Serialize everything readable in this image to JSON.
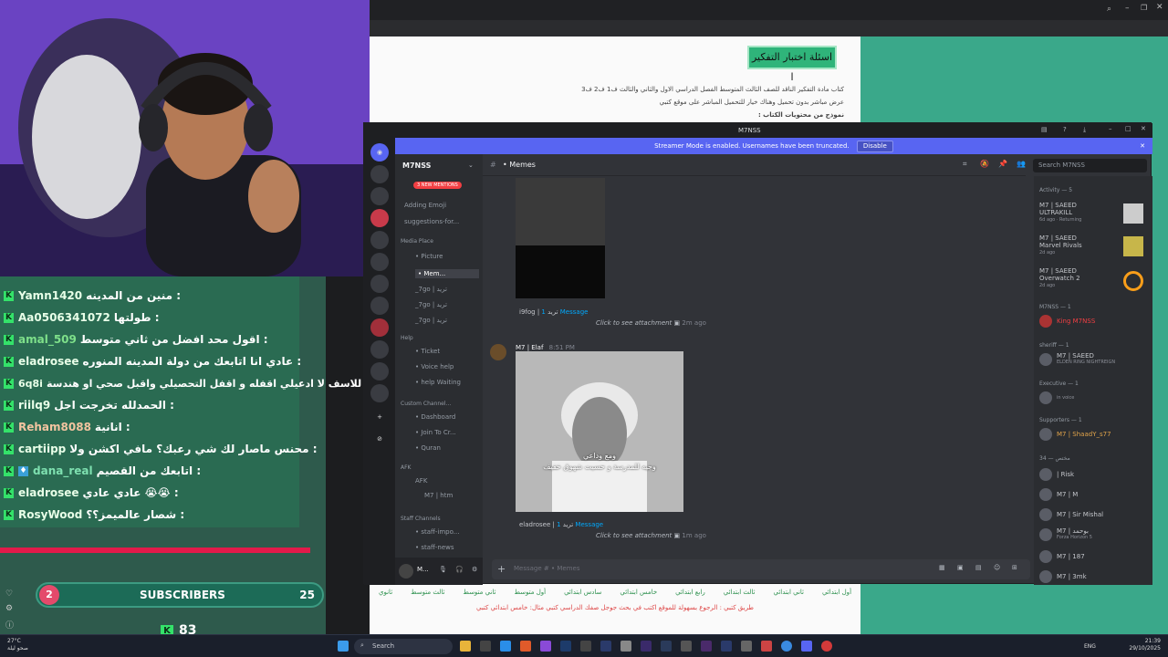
{
  "chat": {
    "messages": [
      {
        "user": "Yamn1420",
        "color": "#e8ffe8",
        "text": "منين من المدينه :"
      },
      {
        "user": "Aa0506341072",
        "color": "#e8ffe8",
        "text": "طولتها :"
      },
      {
        "user": "amal_509",
        "color": "#7ee08a",
        "text": "اقول محد افضل من ثاني متوسط :"
      },
      {
        "user": "eladrosee",
        "color": "#e8ffe8",
        "text": "عادي انا اتابعك من دولة المدينه المنوره :"
      },
      {
        "user": "6q8i",
        "color": "#e8ffe8",
        "text": "للاسف لا ادعيلي اقفله و اقفل التحصيلي واقبل صحي او هندسة :"
      },
      {
        "user": "riilq9",
        "color": "#e8ffe8",
        "text": "الحمدلله تخرجت اجل :"
      },
      {
        "user": "Reham8088",
        "color": "#f2c4a0",
        "text": "انانية :"
      },
      {
        "user": "cartiipp",
        "color": "#e8ffe8",
        "text": "محنس ماصار لك شي رعبك؟ مافي اكشن ولا :"
      },
      {
        "user": "dana_real",
        "color": "#7ee0b0",
        "text": "اتابعك من القصيم :"
      },
      {
        "user": "eladrosee",
        "color": "#e8ffe8",
        "text": "عادي عادي 😭😭 :"
      },
      {
        "user": "RosyWood",
        "color": "#e8ffe8",
        "text": "شصار عالميمز؟؟ :"
      }
    ]
  },
  "subs": {
    "current": "2",
    "label": "SUBSCRIBERS",
    "goal": "25"
  },
  "kick_followers": "83",
  "article": {
    "highlight": "اسئلة اختبار التفكير ا",
    "line1": "كتاب مادة التفكير الناقد للصف الثالث المتوسط الفصل الدراسي الاول والثاني والثالث ف1 ف2 ف3",
    "line2": "عرض مباشر بدون تحميل وهناك خيار للتحميل المباشر على موقع كتبي",
    "line3": "نموذج من محتويات الكتاب :",
    "bottom_tabs": [
      "ثانوي",
      "ثالث متوسط",
      "ثاني متوسط",
      "أول متوسط",
      "سادس ابتدائي",
      "خامس ابتدائي",
      "رابع ابتدائي",
      "ثالث ابتدائي",
      "ثاني ابتدائي",
      "أول ابتدائي"
    ],
    "footer": "طريق كتبي : الرجوع بسهولة للموقع اكتب في بحث جوجل صفك الدراسي كتبي مثال: خامس ابتدائي كتبي"
  },
  "discord": {
    "window_title": "M7NSS",
    "streamer_notice": "Streamer Mode is enabled. Usernames have been truncated.",
    "disable_label": "Disable",
    "server_name": "M7NSS",
    "new_mentions": "3 NEW MENTIONS",
    "channels": [
      {
        "label": "Adding Emoji"
      },
      {
        "label": "suggestions-for..."
      }
    ],
    "categories": {
      "media": "Media Place",
      "help": "Help",
      "custom": "Custom Channel...",
      "afk": "AFK",
      "staff": "Staff Channels"
    },
    "media_channels": [
      "• Picture",
      "• Mem...",
      "_7go | تريد",
      "_7go | تريد",
      "_7go | تريد"
    ],
    "help_channels": [
      "• Ticket",
      "• Voice help",
      "• help Waiting"
    ],
    "custom_channels": [
      "• Dashboard",
      "• Join To Cr...",
      "• Quran"
    ],
    "afk_channels": [
      "AFK",
      "M7 | htm"
    ],
    "staff_channels": [
      "• staff-impo...",
      "• staff-news"
    ],
    "channel_name": "• Memes",
    "search_placeholder": "Search M7NSS",
    "message1": {
      "author": "i9fog | تريد",
      "replies": "1 Message",
      "attachment": "Click to see attachment",
      "time": "2m ago"
    },
    "message2": {
      "author": "M7 | Elaf",
      "time_label": "8:51 PM",
      "caption_line1": "ومع وداعي",
      "caption_line2": "وجيه للمدرسة و حسيت شهوق خفيف"
    },
    "message3": {
      "author": "eladrosee | تريد",
      "replies": "1 Message",
      "attachment": "Click to see attachment",
      "time": "1m ago"
    },
    "input_placeholder": "Message # • Memes",
    "user_name": "M...",
    "members": {
      "activity_label": "Activity — 5",
      "activities": [
        {
          "name": "M7 | SAEED",
          "game": "ULTRAKILL",
          "sub": "6d ago · Returning"
        },
        {
          "name": "M7 | SAEED",
          "game": "Marvel Rivals",
          "sub": "2d ago"
        },
        {
          "name": "M7 | SAEED",
          "game": "Overwatch 2",
          "sub": "2d ago"
        }
      ],
      "sections": [
        {
          "title": "M7NSS — 1",
          "members": [
            {
              "name": "King M7NSS",
              "sub": "",
              "color": "#f23f43"
            }
          ]
        },
        {
          "title": "sheriff — 1",
          "members": [
            {
              "name": "M7 | SAEED",
              "sub": "ELDEN RING NIGHTREIGN",
              "color": "#c4c6cb"
            }
          ]
        },
        {
          "title": "Executive — 1",
          "members": [
            {
              "name": "",
              "sub": "in voice",
              "color": "#c4c6cb"
            }
          ]
        },
        {
          "title": "Supporters — 1",
          "members": [
            {
              "name": "M7 | ShaadY_s77",
              "sub": "",
              "color": "#e0a34a"
            }
          ]
        },
        {
          "title": "34 — مختص",
          "members": [
            {
              "name": "| Risk",
              "sub": "",
              "color": "#c4c6cb"
            },
            {
              "name": "M7 | M",
              "sub": "",
              "color": "#c4c6cb"
            },
            {
              "name": "M7 | Sir Mishal",
              "sub": "",
              "color": "#c4c6cb"
            },
            {
              "name": "M7 | بوحمد",
              "sub": "Forza Horizon 5",
              "color": "#c4c6cb"
            },
            {
              "name": "M7 | 187",
              "sub": "",
              "color": "#c4c6cb"
            },
            {
              "name": "M7 | 3mk",
              "sub": "",
              "color": "#c4c6cb"
            }
          ]
        }
      ]
    }
  },
  "taskbar": {
    "weather_temp": "27°C",
    "weather_desc": "صحو ليلة",
    "search_placeholder": "Search",
    "lang": "ENG",
    "time": "21:39",
    "date": "29/10/2025"
  }
}
